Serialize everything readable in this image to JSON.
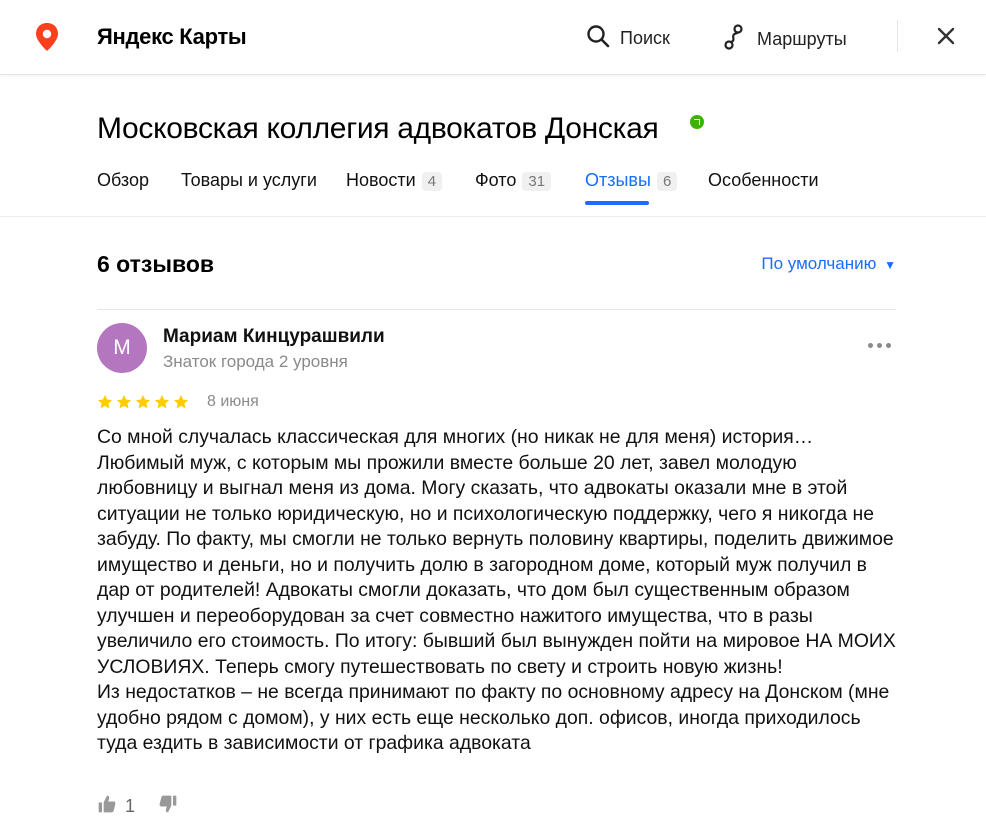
{
  "header": {
    "brand": "Яндекс Карты",
    "search_label": "Поиск",
    "routes_label": "Маршруты",
    "icons": [
      "map-pin-icon",
      "search-icon",
      "routes-icon",
      "close-icon"
    ]
  },
  "organization": {
    "name": "Московская коллегия адвокатов Донская",
    "verified": true,
    "verified_color": "#3bb300"
  },
  "tabs": [
    {
      "label": "Обзор",
      "count": ""
    },
    {
      "label": "Товары и услуги",
      "count": ""
    },
    {
      "label": "Новости",
      "count": "4"
    },
    {
      "label": "Фото",
      "count": "31"
    },
    {
      "label": "Отзывы",
      "count": "6",
      "active": true
    },
    {
      "label": "Особенности",
      "count": ""
    }
  ],
  "reviews": {
    "count_label": "6 отзывов",
    "sort_label": "По умолчанию",
    "accent_color": "#196dff"
  },
  "review": {
    "avatar_letter": "М",
    "avatar_color": "#b477bf",
    "author": "Мариам Кинцурашвили",
    "level": "Знаток города 2 уровня",
    "rating": 5,
    "date": "8 июня",
    "text": "Со мной случалась классическая для многих (но никак не для меня) история…\nЛюбимый муж, с которым мы прожили вместе больше 20 лет, завел молодую любовницу и выгнал меня из дома. Могу сказать, что адвокаты оказали мне в этой ситуации не только юридическую, но и психологическую поддержку, чего я никогда не забуду. По факту, мы смогли не только вернуть половину квартиры, поделить движимое имущество и деньги, но и получить долю в загородном доме, который муж получил в дар от родителей! Адвокаты смогли доказать, что дом был существенным образом улучшен и переоборудован за счет совместно нажитого имущества, что в разы увеличило его стоимость. По итогу: бывший был вынужден пойти на мировое НА МОИХ УСЛОВИЯХ. Теперь смогу путешествовать по свету и строить новую жизнь!\nИз недостатков – не всегда принимают по факту по основному адресу на Донском (мне удобно рядом с домом), у них есть еще несколько доп. офисов, иногда приходилось туда ездить в зависимости от графика адвоката",
    "likes": "1"
  }
}
